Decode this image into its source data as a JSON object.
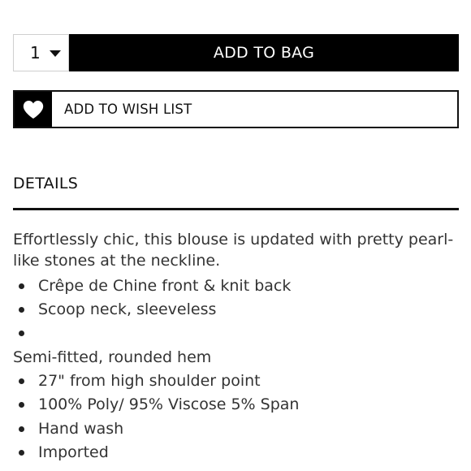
{
  "purchase": {
    "quantity": "1",
    "add_to_bag_label": "ADD TO BAG"
  },
  "wishlist": {
    "label": "ADD TO WISH LIST"
  },
  "details": {
    "heading": "DETAILS",
    "description": "Effortlessly chic, this blouse is updated with pretty pearl-like stones at the neckline.",
    "bullets_a": [
      "Crêpe de Chine front & knit back",
      "Scoop neck, sleeveless",
      ""
    ],
    "plain_line": "Semi-fitted, rounded hem",
    "bullets_b": [
      "27\" from high shoulder point",
      "100% Poly/ 95% Viscose 5% Span",
      "Hand wash",
      "Imported"
    ]
  },
  "colors": {
    "button_bg": "#000000",
    "button_text": "#ffffff",
    "body_text": "#333333"
  }
}
